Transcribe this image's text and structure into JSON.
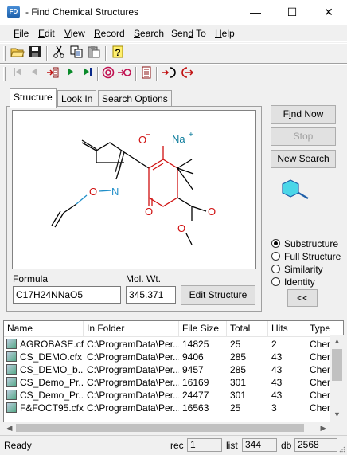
{
  "window": {
    "icon_text": "FD",
    "title": "- Find Chemical Structures",
    "minimize": "—",
    "maximize": "☐",
    "close": "✕"
  },
  "menu": [
    {
      "label": "File",
      "key": "F",
      "rest": "ile"
    },
    {
      "label": "Edit",
      "key": "E",
      "rest": "dit"
    },
    {
      "label": "View",
      "key": "V",
      "rest": "iew"
    },
    {
      "label": "Record",
      "key": "R",
      "rest": "ecord"
    },
    {
      "label": "Search",
      "key": "S",
      "rest": "earch"
    },
    {
      "label": "Send To",
      "pre": "Sen",
      "key": "d",
      "rest": " To"
    },
    {
      "label": "Help",
      "key": "H",
      "rest": "elp"
    }
  ],
  "tabs": {
    "structure": "Structure",
    "look_in": "Look In",
    "search_options": "Search Options"
  },
  "molecule": {
    "o_minus": "O",
    "minus": "−",
    "na": "Na",
    "plus": "+",
    "n": "N",
    "o_oxime": "O",
    "o_ketone": "O",
    "o_carbonyl": "O",
    "o_ester": "O"
  },
  "form": {
    "formula_label": "Formula",
    "formula_value": "C17H24NNaO5",
    "molwt_label": "Mol. Wt.",
    "molwt_value": "345.371",
    "edit_structure": "Edit Structure"
  },
  "buttons": {
    "find_now": "Find Now",
    "find_now_key": "i",
    "stop": "Stop",
    "new_search": "New Search",
    "new_search_key": "w",
    "collapse": "<<"
  },
  "search_type": {
    "selected": "Substructure",
    "options": [
      "Substructure",
      "Full Structure",
      "Similarity",
      "Identity"
    ]
  },
  "list": {
    "columns": [
      "Name",
      "In Folder",
      "File Size",
      "Total",
      "Hits",
      "Type"
    ],
    "rows": [
      {
        "name": "AGROBASE.cfx",
        "folder": "C:\\ProgramData\\Per...",
        "size": "14825",
        "total": "25",
        "hits": "2",
        "type": "Cher"
      },
      {
        "name": "CS_DEMO.cfx",
        "folder": "C:\\ProgramData\\Per...",
        "size": "9406",
        "total": "285",
        "hits": "43",
        "type": "Cher"
      },
      {
        "name": "CS_DEMO_b...",
        "folder": "C:\\ProgramData\\Per...",
        "size": "9457",
        "total": "285",
        "hits": "43",
        "type": "Cher"
      },
      {
        "name": "CS_Demo_Pr...",
        "folder": "C:\\ProgramData\\Per...",
        "size": "16169",
        "total": "301",
        "hits": "43",
        "type": "Cher"
      },
      {
        "name": "CS_Demo_Pr...",
        "folder": "C:\\ProgramData\\Per...",
        "size": "24477",
        "total": "301",
        "hits": "43",
        "type": "Cher"
      },
      {
        "name": "F&FOCT95.cfx",
        "folder": "C:\\ProgramData\\Per...",
        "size": "16563",
        "total": "25",
        "hits": "3",
        "type": "Cher"
      }
    ]
  },
  "status": {
    "text": "Ready",
    "rec_label": "rec",
    "rec_value": "1",
    "list_label": "list",
    "list_value": "344",
    "db_label": "db",
    "db_value": "2568"
  },
  "colors": {
    "red_ring": "#d01010",
    "accent": "#0a7a9a",
    "blue_mol": "#1f8ec8",
    "cyan_mol": "#4bd6e8"
  }
}
